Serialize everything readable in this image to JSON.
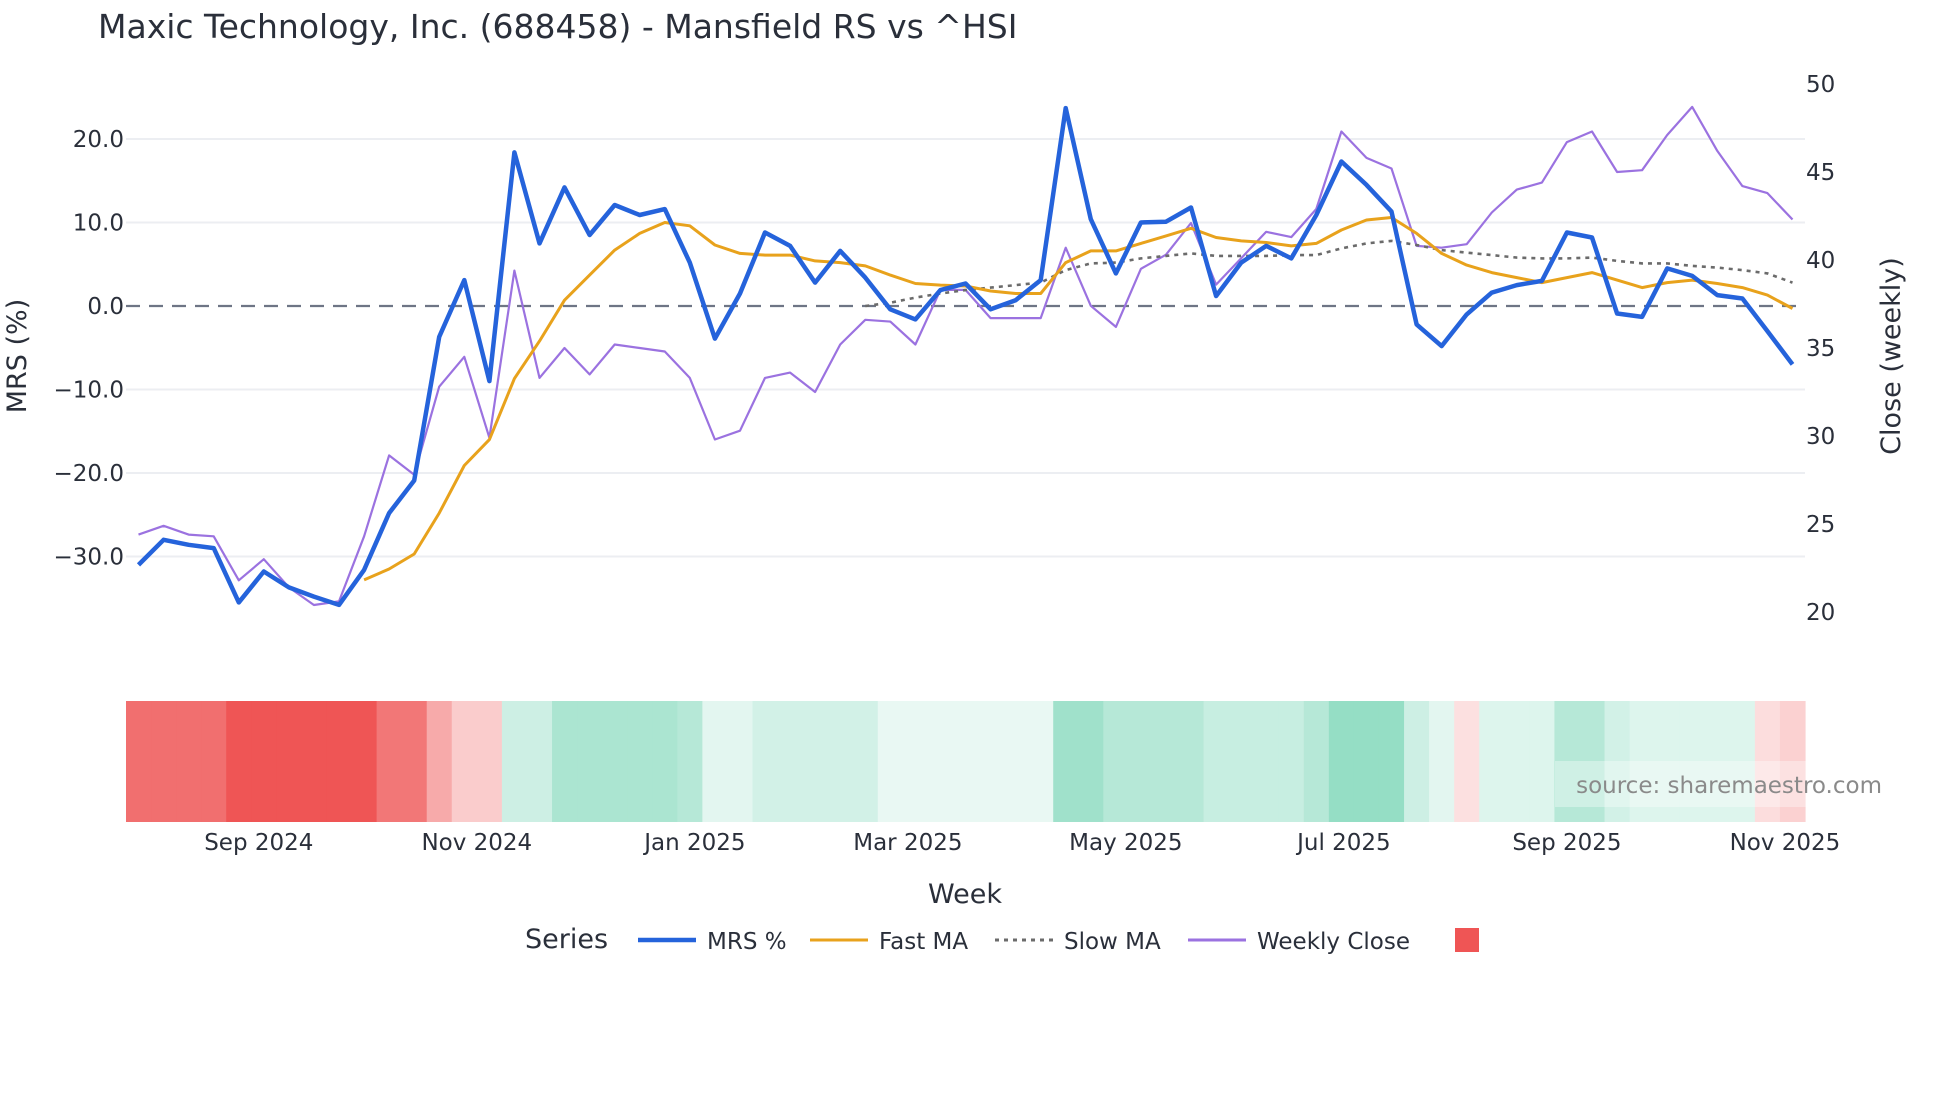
{
  "chart_data": {
    "type": "line",
    "title": "Maxic Technology, Inc. (688458) - Mansfield RS vs ^HSI",
    "xlabel": "Week",
    "ylabel": "MRS (%)",
    "y2label": "Close (weekly)",
    "ylim": [
      -39,
      27
    ],
    "y2lim": [
      17,
      51
    ],
    "yticks": [
      -30,
      -20,
      -10,
      0,
      10,
      20
    ],
    "ytick_labels": [
      "−30.0",
      "−20.0",
      "−10.0",
      "0.0",
      "10.0",
      "20.0"
    ],
    "y2ticks": [
      20,
      25,
      30,
      35,
      40,
      45,
      50
    ],
    "y2tick_labels": [
      "20",
      "25",
      "30",
      "35",
      "40",
      "45",
      "50"
    ],
    "xtick_labels": [
      "Sep 2024",
      "Nov 2024",
      "Jan 2025",
      "Mar 2025",
      "May 2025",
      "Jul 2025",
      "Sep 2025",
      "Nov 2025"
    ],
    "xtick_week_index": [
      5.3,
      14.0,
      22.7,
      31.2,
      39.9,
      48.6,
      57.5,
      66.2
    ],
    "grid": true,
    "legend_title": "Series",
    "legend_position": "bottom",
    "source": "source: sharemaestro.com",
    "zero_line": 0,
    "series": [
      {
        "name": "MRS %",
        "color": "#2563db",
        "axis": "left",
        "start": 0,
        "values": [
          -31,
          -28,
          -28.6,
          -29,
          -35.5,
          -31.8,
          -33.7,
          -34.8,
          -35.8,
          -31.6,
          -24.8,
          -20.9,
          -3.7,
          3.1,
          -9,
          18.4,
          7.5,
          14.2,
          8.5,
          12.1,
          10.9,
          11.6,
          5.2,
          -3.9,
          1.5,
          8.8,
          7.2,
          2.8,
          6.6,
          3.4,
          -0.4,
          -1.6,
          1.9,
          2.7,
          -0.4,
          0.7,
          3.1,
          23.7,
          10.4,
          3.9,
          10,
          10.1,
          11.8,
          1.2,
          5.2,
          7.2,
          5.7,
          10.9,
          17.3,
          14.5,
          11.3,
          -2.2,
          -4.8,
          -1,
          1.6,
          2.5,
          3,
          8.8,
          8.2,
          -0.9,
          -1.3,
          4.5,
          3.6,
          1.3,
          0.9,
          -3,
          -7
        ]
      },
      {
        "name": "Fast MA",
        "color": "#e8a21c",
        "axis": "left",
        "start": 9,
        "values": [
          -32.8,
          -31.5,
          -29.7,
          -24.8,
          -19.1,
          -16,
          -8.7,
          -4.2,
          0.7,
          3.7,
          6.7,
          8.7,
          10,
          9.6,
          7.3,
          6.3,
          6.1,
          6.1,
          5.4,
          5.2,
          4.8,
          3.7,
          2.7,
          2.5,
          2.4,
          1.8,
          1.5,
          1.5,
          5.2,
          6.6,
          6.6,
          7.5,
          8.4,
          9.3,
          8.2,
          7.8,
          7.6,
          7.2,
          7.5,
          9.1,
          10.3,
          10.6,
          8.7,
          6.3,
          4.9,
          4,
          3.4,
          2.8,
          3.4,
          4,
          3.1,
          2.2,
          2.8,
          3.1,
          2.7,
          2.2,
          1.3,
          -0.3
        ]
      },
      {
        "name": "Slow MA",
        "color": "#6b6b6b",
        "axis": "left",
        "start": 29,
        "dash": true,
        "values": [
          0,
          0.4,
          1,
          1.5,
          1.9,
          2.2,
          2.5,
          2.8,
          4.3,
          5.1,
          5.2,
          5.7,
          6,
          6.3,
          6,
          6,
          6,
          6.1,
          6.1,
          6.9,
          7.5,
          7.8,
          7.3,
          6.7,
          6.4,
          6.1,
          5.8,
          5.7,
          5.7,
          5.8,
          5.4,
          5.1,
          5.1,
          4.8,
          4.6,
          4.3,
          3.9,
          2.8
        ]
      },
      {
        "name": "Weekly Close",
        "color": "#9b72e0",
        "axis": "right",
        "start": 0,
        "values": [
          24.4,
          24.9,
          24.4,
          24.3,
          21.8,
          23.0,
          21.4,
          20.4,
          20.6,
          24.3,
          28.9,
          27.8,
          32.8,
          34.5,
          29.9,
          39.4,
          33.3,
          35.0,
          33.5,
          35.2,
          35.0,
          34.8,
          33.3,
          29.8,
          30.3,
          33.3,
          33.6,
          32.5,
          35.2,
          36.6,
          36.5,
          35.2,
          38.3,
          38.3,
          36.7,
          36.7,
          36.7,
          40.7,
          37.4,
          36.2,
          39.5,
          40.3,
          42.1,
          38.6,
          40.1,
          41.6,
          41.3,
          42.9,
          47.3,
          45.8,
          45.2,
          40.8,
          40.7,
          40.9,
          42.7,
          44.0,
          44.4,
          46.7,
          47.3,
          45.0,
          45.1,
          47.1,
          48.7,
          46.2,
          44.2,
          43.8,
          42.3
        ]
      }
    ],
    "heat": {
      "negative_color": "#ef5555",
      "positive_color": "#8fdcc2",
      "values": [
        -0.85,
        -0.85,
        -0.85,
        -0.85,
        -1,
        -1,
        -1,
        -1,
        -1,
        -1,
        -0.8,
        -0.8,
        -0.5,
        -0.3,
        -0.3,
        0.45,
        0.45,
        0.75,
        0.75,
        0.75,
        0.75,
        0.75,
        0.65,
        0.25,
        0.25,
        0.4,
        0.4,
        0.4,
        0.4,
        0.4,
        0.2,
        0.2,
        0.2,
        0.2,
        0.2,
        0.2,
        0.2,
        0.85,
        0.85,
        0.65,
        0.65,
        0.65,
        0.65,
        0.5,
        0.5,
        0.5,
        0.5,
        0.65,
        0.95,
        0.95,
        0.95,
        0.45,
        0.25,
        -0.18,
        0.3,
        0.3,
        0.3,
        0.65,
        0.65,
        0.4,
        0.3,
        0.3,
        0.3,
        0.3,
        0.3,
        -0.2,
        -0.27
      ]
    }
  }
}
